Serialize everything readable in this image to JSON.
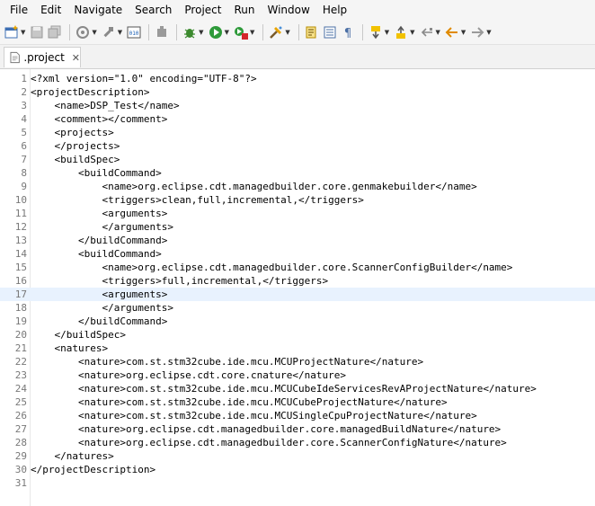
{
  "menubar": [
    "File",
    "Edit",
    "Navigate",
    "Search",
    "Project",
    "Run",
    "Window",
    "Help"
  ],
  "toolbar": {
    "icons": [
      "new-icon",
      "save-icon",
      "save-all-icon",
      "print-icon",
      "build-icon",
      "binary-icon",
      "run-debug-icon",
      "debug-icon",
      "run-icon",
      "external-tools-icon",
      "search-icon",
      "show-whitespace-icon",
      "annotation-next-icon",
      "annotation-prev-icon",
      "last-edit-icon",
      "back-icon",
      "forward-icon"
    ]
  },
  "editor": {
    "tab_label": ".project",
    "current_line": 17,
    "lines": [
      {
        "n": "1",
        "text": "<?xml version=\"1.0\" encoding=\"UTF-8\"?>"
      },
      {
        "n": "2",
        "text": "<projectDescription>"
      },
      {
        "n": "3",
        "text": "    <name>DSP_Test</name>"
      },
      {
        "n": "4",
        "text": "    <comment></comment>"
      },
      {
        "n": "5",
        "text": "    <projects>"
      },
      {
        "n": "6",
        "text": "    </projects>"
      },
      {
        "n": "7",
        "text": "    <buildSpec>"
      },
      {
        "n": "8",
        "text": "        <buildCommand>"
      },
      {
        "n": "9",
        "text": "            <name>org.eclipse.cdt.managedbuilder.core.genmakebuilder</name>"
      },
      {
        "n": "10",
        "text": "            <triggers>clean,full,incremental,</triggers>"
      },
      {
        "n": "11",
        "text": "            <arguments>"
      },
      {
        "n": "12",
        "text": "            </arguments>"
      },
      {
        "n": "13",
        "text": "        </buildCommand>"
      },
      {
        "n": "14",
        "text": "        <buildCommand>"
      },
      {
        "n": "15",
        "text": "            <name>org.eclipse.cdt.managedbuilder.core.ScannerConfigBuilder</name>"
      },
      {
        "n": "16",
        "text": "            <triggers>full,incremental,</triggers>"
      },
      {
        "n": "17",
        "text": "            <arguments>"
      },
      {
        "n": "18",
        "text": "            </arguments>"
      },
      {
        "n": "19",
        "text": "        </buildCommand>"
      },
      {
        "n": "20",
        "text": "    </buildSpec>"
      },
      {
        "n": "21",
        "text": "    <natures>"
      },
      {
        "n": "22",
        "text": "        <nature>com.st.stm32cube.ide.mcu.MCUProjectNature</nature>"
      },
      {
        "n": "23",
        "text": "        <nature>org.eclipse.cdt.core.cnature</nature>"
      },
      {
        "n": "24",
        "text": "        <nature>com.st.stm32cube.ide.mcu.MCUCubeIdeServicesRevAProjectNature</nature>"
      },
      {
        "n": "25",
        "text": "        <nature>com.st.stm32cube.ide.mcu.MCUCubeProjectNature</nature>"
      },
      {
        "n": "26",
        "text": "        <nature>com.st.stm32cube.ide.mcu.MCUSingleCpuProjectNature</nature>"
      },
      {
        "n": "27",
        "text": "        <nature>org.eclipse.cdt.managedbuilder.core.managedBuildNature</nature>"
      },
      {
        "n": "28",
        "text": "        <nature>org.eclipse.cdt.managedbuilder.core.ScannerConfigNature</nature>"
      },
      {
        "n": "29",
        "text": "    </natures>"
      },
      {
        "n": "30",
        "text": "</projectDescription>"
      },
      {
        "n": "31",
        "text": ""
      }
    ]
  }
}
